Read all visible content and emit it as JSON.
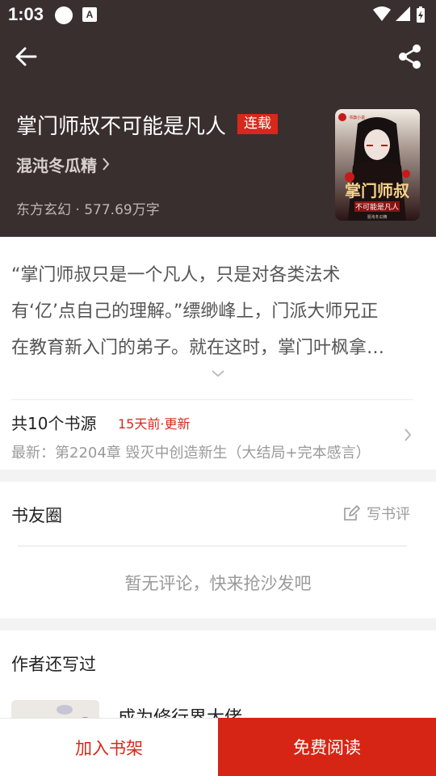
{
  "status_bar": {
    "time": "1:03",
    "icons": [
      "circle-notification-icon",
      "a-notification-icon",
      "wifi-icon",
      "signal-icon",
      "battery-charging-icon"
    ],
    "a_glyph": "A"
  },
  "nav": {
    "back_icon": "arrow-left-icon",
    "share_icon": "share-icon"
  },
  "book": {
    "title": "掌门师叔不可能是凡人",
    "status_badge": "连载",
    "author": "混沌冬瓜精",
    "meta": "东方玄幻 · 577.69万字",
    "cover": {
      "title_text": "掌门师叔",
      "subtitle_text": "不可能是凡人",
      "publisher_mark": "书旗小说",
      "author_mark": "混沌冬瓜精"
    }
  },
  "synopsis": {
    "lines": [
      "“掌门师叔只是一个凡人，只是对各类法术",
      "有‘亿’点自己的理解。”缥缈峰上，门派大师兄正",
      "在教育新入门的弟子。就在这时，掌门叶枫拿…"
    ],
    "expand_icon": "chevron-down-icon"
  },
  "sources": {
    "count": "共10个书源",
    "updated": "15天前·更新",
    "latest": "最新：第2204章 毁灭中创造新生（大结局+完本感言）"
  },
  "reviews": {
    "title": "书友圈",
    "write_label": "写书评",
    "empty_text": "暂无评论，快来抢沙发吧"
  },
  "author_works": {
    "title": "作者还写过",
    "items": [
      {
        "title": "成为修行界大佬"
      }
    ]
  },
  "bottom": {
    "add_shelf": "加入书架",
    "read_free": "免费阅读"
  },
  "colors": {
    "hero_bg": "#3a2f2f",
    "accent_red": "#d6281b",
    "read_button_bg": "#d62515",
    "section_gap": "#f3f3f3"
  }
}
